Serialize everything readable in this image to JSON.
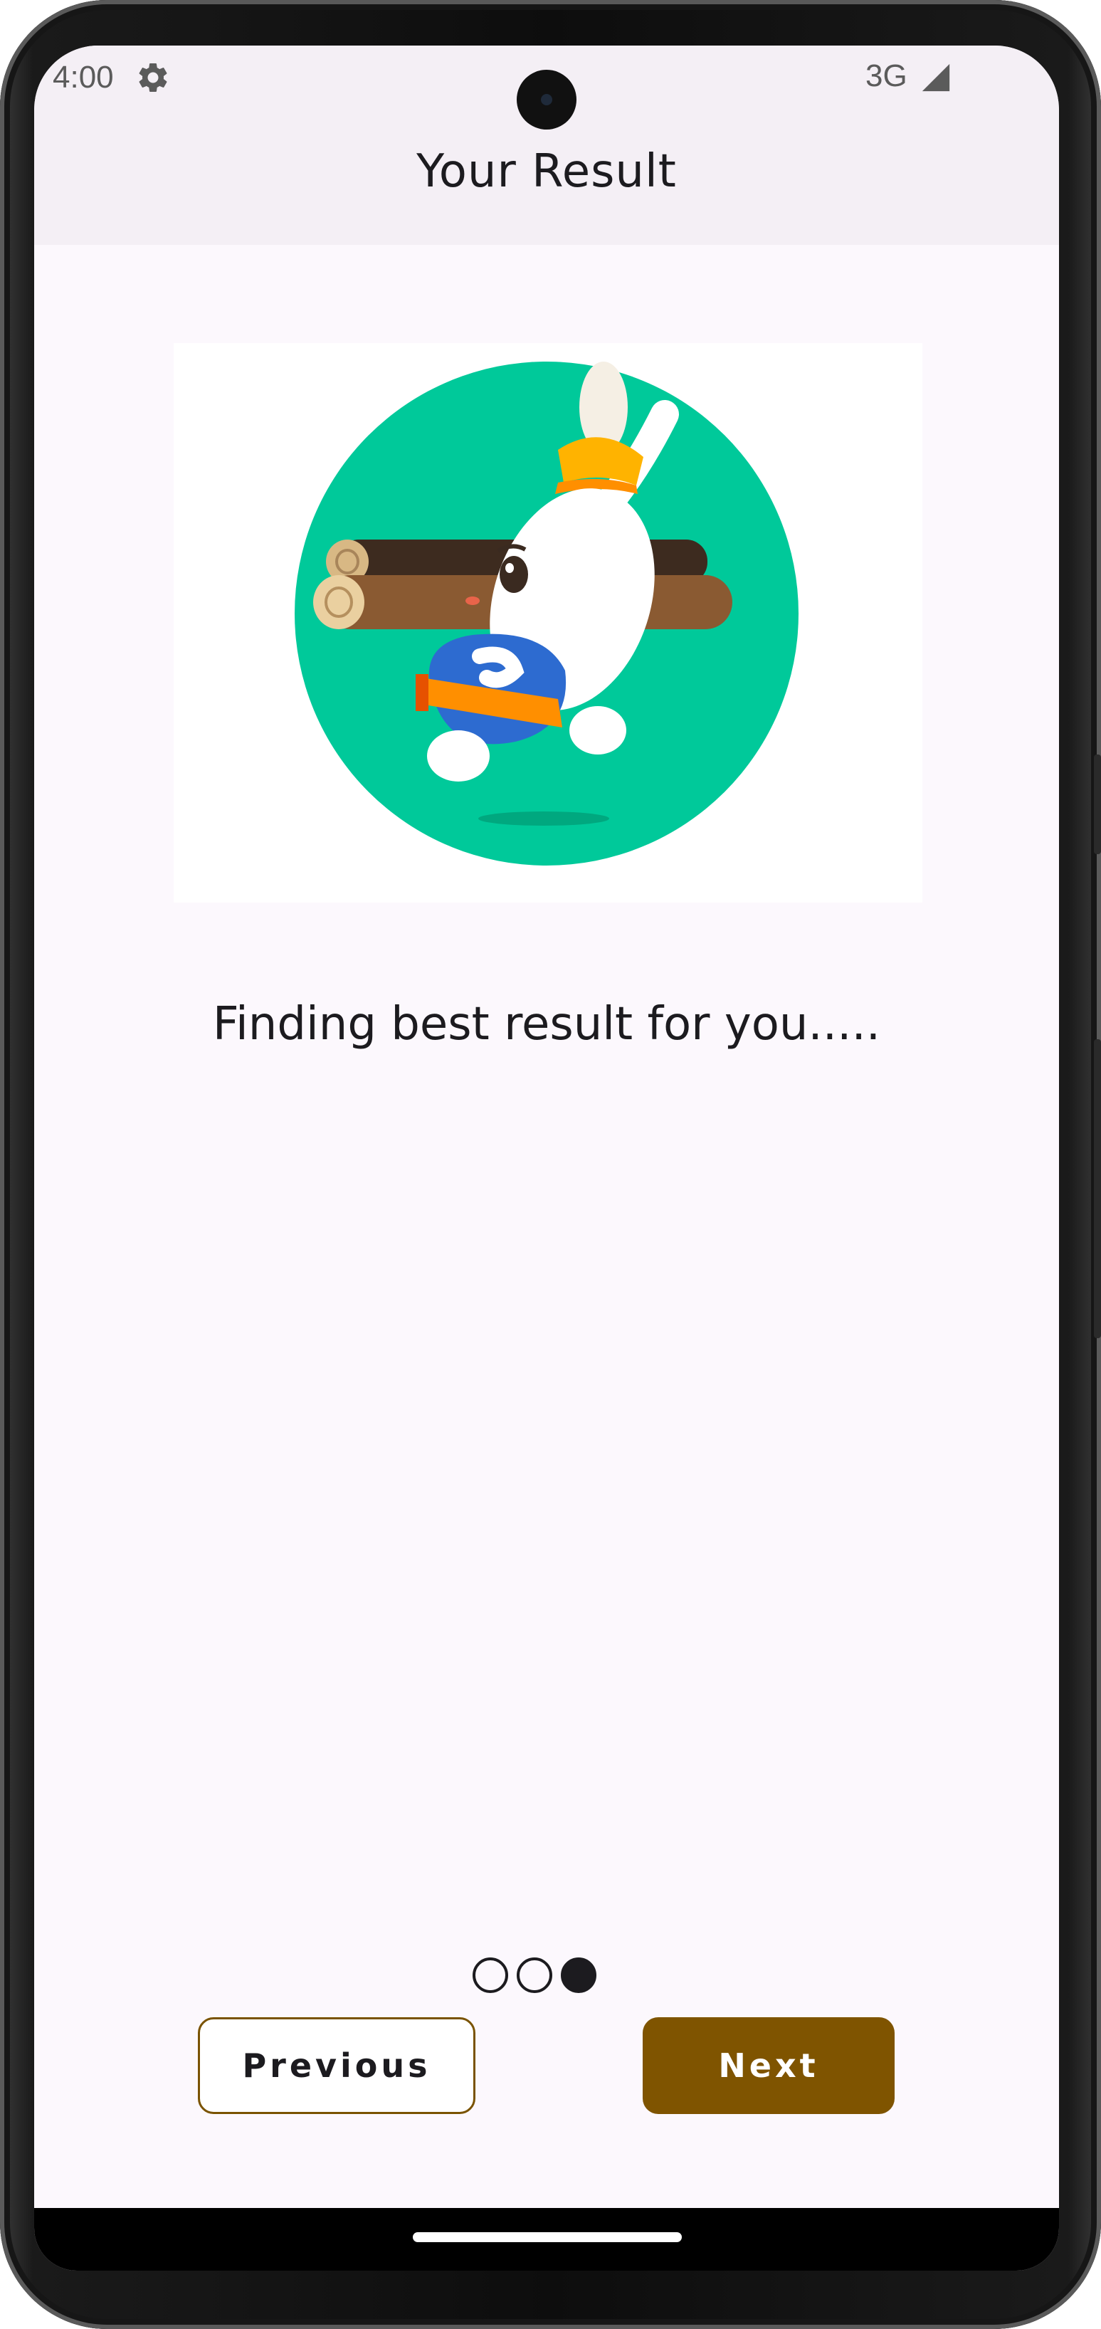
{
  "status_bar": {
    "time": "4:00",
    "network": "3G",
    "icons": [
      "gear-icon",
      "signal-icon",
      "camera-cutout"
    ]
  },
  "header": {
    "title": "Your Result"
  },
  "main": {
    "illustration": "rabbit-carrying-logs-illustration",
    "message": "Finding best result for you....."
  },
  "pager": {
    "total": 3,
    "active_index": 2
  },
  "actions": {
    "previous_label": "Previous",
    "next_label": "Next"
  },
  "colors": {
    "primary": "#7f5400",
    "background": "#fcf8fd",
    "appbar": "#f4eff5",
    "illustration_circle": "#00c99a"
  }
}
